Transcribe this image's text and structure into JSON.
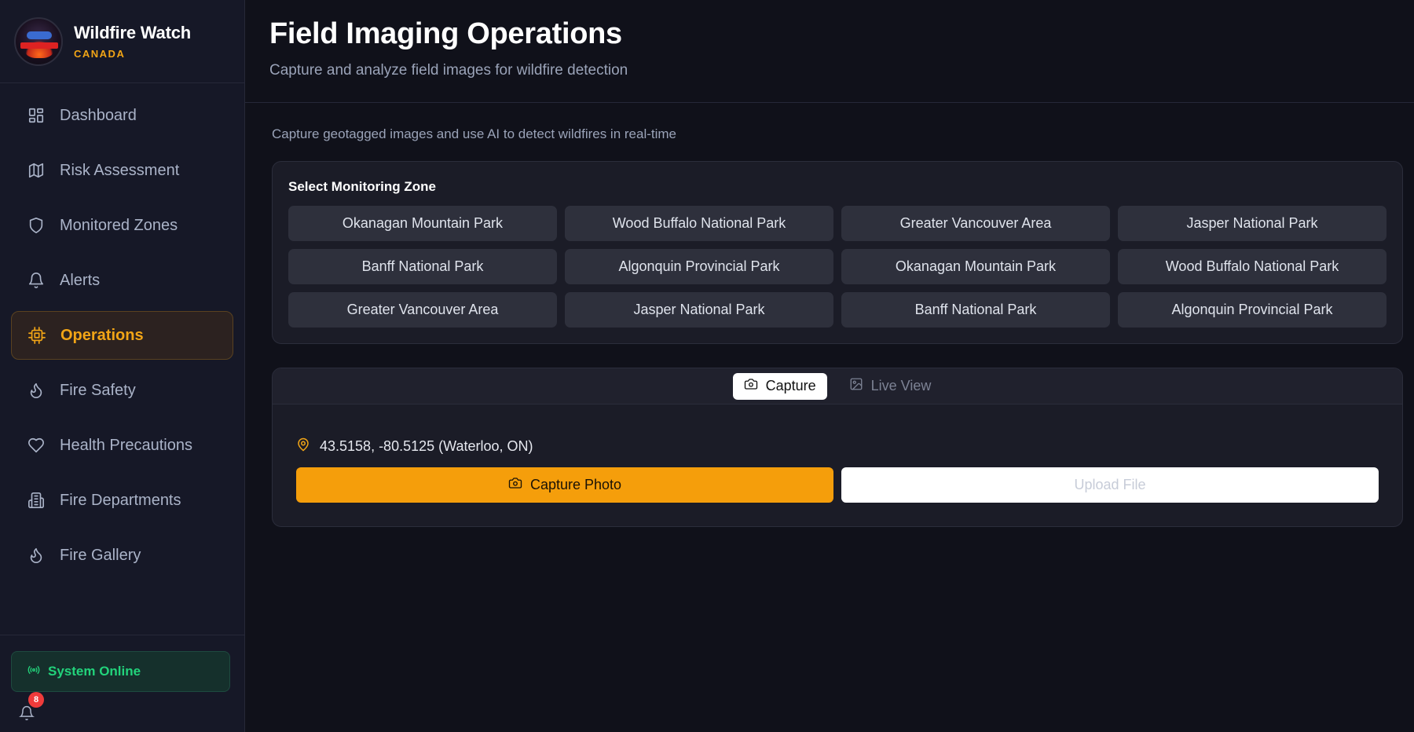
{
  "brand": {
    "title": "Wildfire Watch",
    "subtitle": "CANADA"
  },
  "sidebar": {
    "items": [
      {
        "label": "Dashboard",
        "icon": "dashboard-icon"
      },
      {
        "label": "Risk Assessment",
        "icon": "map-icon"
      },
      {
        "label": "Monitored Zones",
        "icon": "shield-icon"
      },
      {
        "label": "Alerts",
        "icon": "bell-icon"
      },
      {
        "label": "Operations",
        "icon": "cpu-icon",
        "active": true
      },
      {
        "label": "Fire Safety",
        "icon": "flame-icon"
      },
      {
        "label": "Health Precautions",
        "icon": "heart-icon"
      },
      {
        "label": "Fire Departments",
        "icon": "building-icon"
      },
      {
        "label": "Fire Gallery",
        "icon": "flame-icon"
      }
    ],
    "status": "System Online",
    "notifications": {
      "count": "8"
    }
  },
  "header": {
    "title": "Field Imaging Operations",
    "subtitle": "Capture and analyze field images for wildfire detection"
  },
  "main": {
    "description": "Capture geotagged images and use AI to detect wildfires in real-time",
    "zones": {
      "title": "Select Monitoring Zone",
      "items": [
        "Okanagan Mountain Park",
        "Wood Buffalo National Park",
        "Greater Vancouver Area",
        "Jasper National Park",
        "Banff National Park",
        "Algonquin Provincial Park",
        "Okanagan Mountain Park",
        "Wood Buffalo National Park",
        "Greater Vancouver Area",
        "Jasper National Park",
        "Banff National Park",
        "Algonquin Provincial Park"
      ]
    },
    "capture": {
      "tabs": [
        {
          "label": "Capture",
          "active": true
        },
        {
          "label": "Live View",
          "active": false
        }
      ],
      "location": "43.5158, -80.5125 (Waterloo, ON)",
      "capture_button": "Capture Photo",
      "upload_button": "Upload File"
    }
  },
  "colors": {
    "accent": "#f59e0b",
    "online": "#22d37b",
    "badge": "#ef3b3b",
    "background": "#10111a"
  }
}
